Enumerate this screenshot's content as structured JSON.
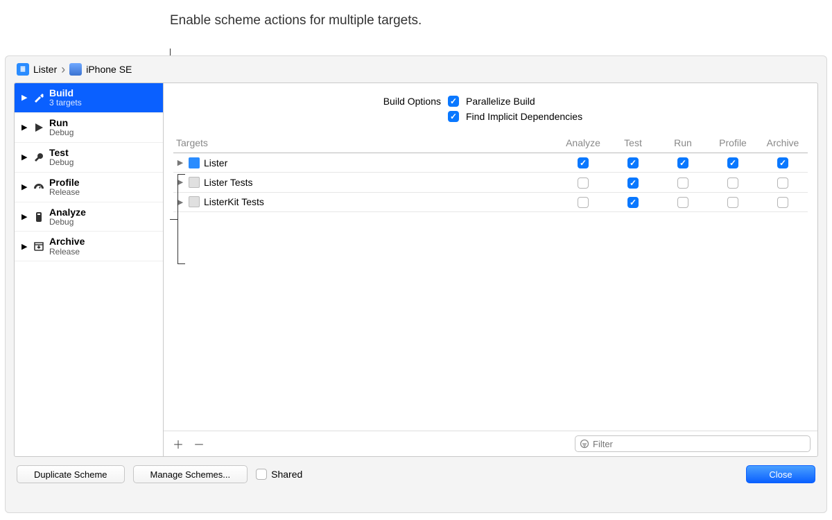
{
  "caption": "Enable scheme actions for multiple targets.",
  "breadcrumb": {
    "scheme": "Lister",
    "device": "iPhone SE"
  },
  "actions": [
    {
      "name": "Build",
      "subtitle": "3 targets",
      "selected": true
    },
    {
      "name": "Run",
      "subtitle": "Debug",
      "selected": false
    },
    {
      "name": "Test",
      "subtitle": "Debug",
      "selected": false
    },
    {
      "name": "Profile",
      "subtitle": "Release",
      "selected": false
    },
    {
      "name": "Analyze",
      "subtitle": "Debug",
      "selected": false
    },
    {
      "name": "Archive",
      "subtitle": "Release",
      "selected": false
    }
  ],
  "build_options": {
    "label": "Build Options",
    "parallelize": {
      "label": "Parallelize Build",
      "checked": true
    },
    "implicit": {
      "label": "Find Implicit Dependencies",
      "checked": true
    }
  },
  "columns": {
    "targets": "Targets",
    "analyze": "Analyze",
    "test": "Test",
    "run": "Run",
    "profile": "Profile",
    "archive": "Archive"
  },
  "targets": [
    {
      "name": "Lister",
      "icon": "app",
      "analyze": true,
      "test": true,
      "run": true,
      "profile": true,
      "archive": true
    },
    {
      "name": "Lister Tests",
      "icon": "test",
      "analyze": false,
      "test": true,
      "run": false,
      "profile": false,
      "archive": false
    },
    {
      "name": "ListerKit Tests",
      "icon": "test",
      "analyze": false,
      "test": true,
      "run": false,
      "profile": false,
      "archive": false
    }
  ],
  "filter_placeholder": "Filter",
  "footer": {
    "duplicate": "Duplicate Scheme",
    "manage": "Manage Schemes...",
    "shared": "Shared",
    "close": "Close"
  }
}
